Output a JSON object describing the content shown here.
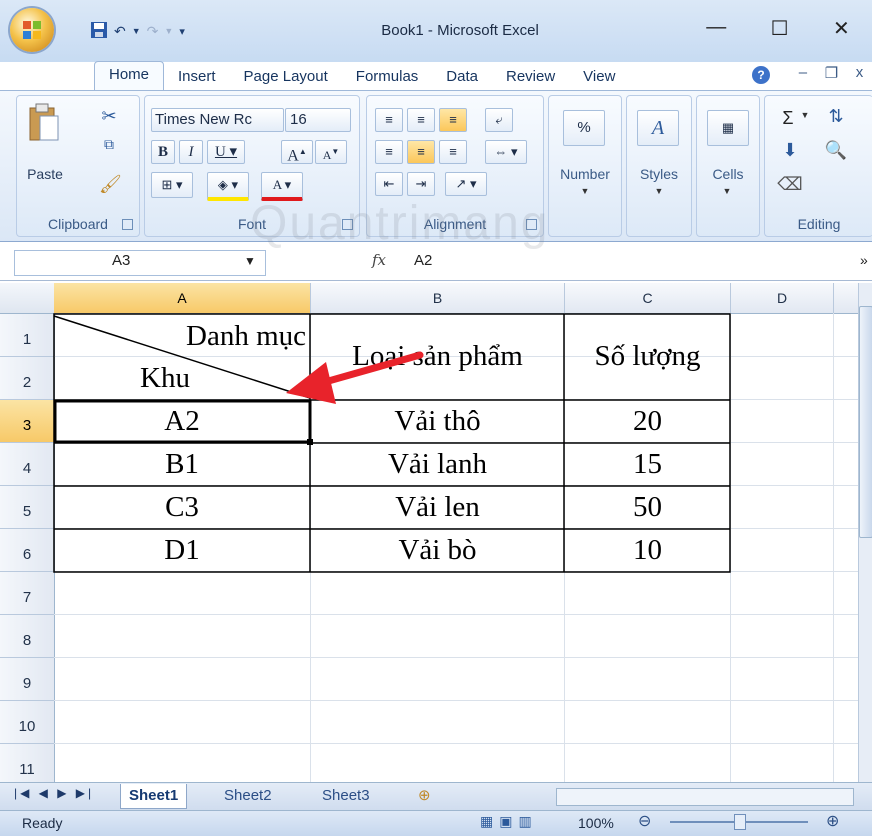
{
  "window": {
    "title": "Book1 - Microsoft Excel"
  },
  "tabs": [
    "Home",
    "Insert",
    "Page Layout",
    "Formulas",
    "Data",
    "Review",
    "View"
  ],
  "ribbon": {
    "clipboard": {
      "label": "Clipboard",
      "paste": "Paste"
    },
    "font": {
      "label": "Font",
      "name": "Times New Rc",
      "size": "16"
    },
    "alignment": {
      "label": "Alignment"
    },
    "number": {
      "label": "Number",
      "symbol": "%"
    },
    "styles": {
      "label": "Styles"
    },
    "cells": {
      "label": "Cells"
    },
    "editing": {
      "label": "Editing",
      "sum": "Σ"
    }
  },
  "formula_bar": {
    "name_box": "A3",
    "fx": "fx",
    "value": "A2"
  },
  "columns": [
    "A",
    "B",
    "C",
    "D"
  ],
  "rows": [
    "1",
    "2",
    "3",
    "4",
    "5",
    "6",
    "7",
    "8",
    "9",
    "10",
    "11"
  ],
  "table": {
    "header_diag_top": "Danh mục",
    "header_diag_bottom": "Khu",
    "header_b": "Loại sản phẩm",
    "header_c": "Số lượng",
    "data": [
      [
        "A2",
        "Vải thô",
        "20"
      ],
      [
        "B1",
        "Vải lanh",
        "15"
      ],
      [
        "C3",
        "Vải len",
        "50"
      ],
      [
        "D1",
        "Vải bò",
        "10"
      ]
    ]
  },
  "sheets": [
    "Sheet1",
    "Sheet2",
    "Sheet3"
  ],
  "status": {
    "ready": "Ready",
    "zoom": "100%"
  },
  "watermark": "Quantrimang"
}
